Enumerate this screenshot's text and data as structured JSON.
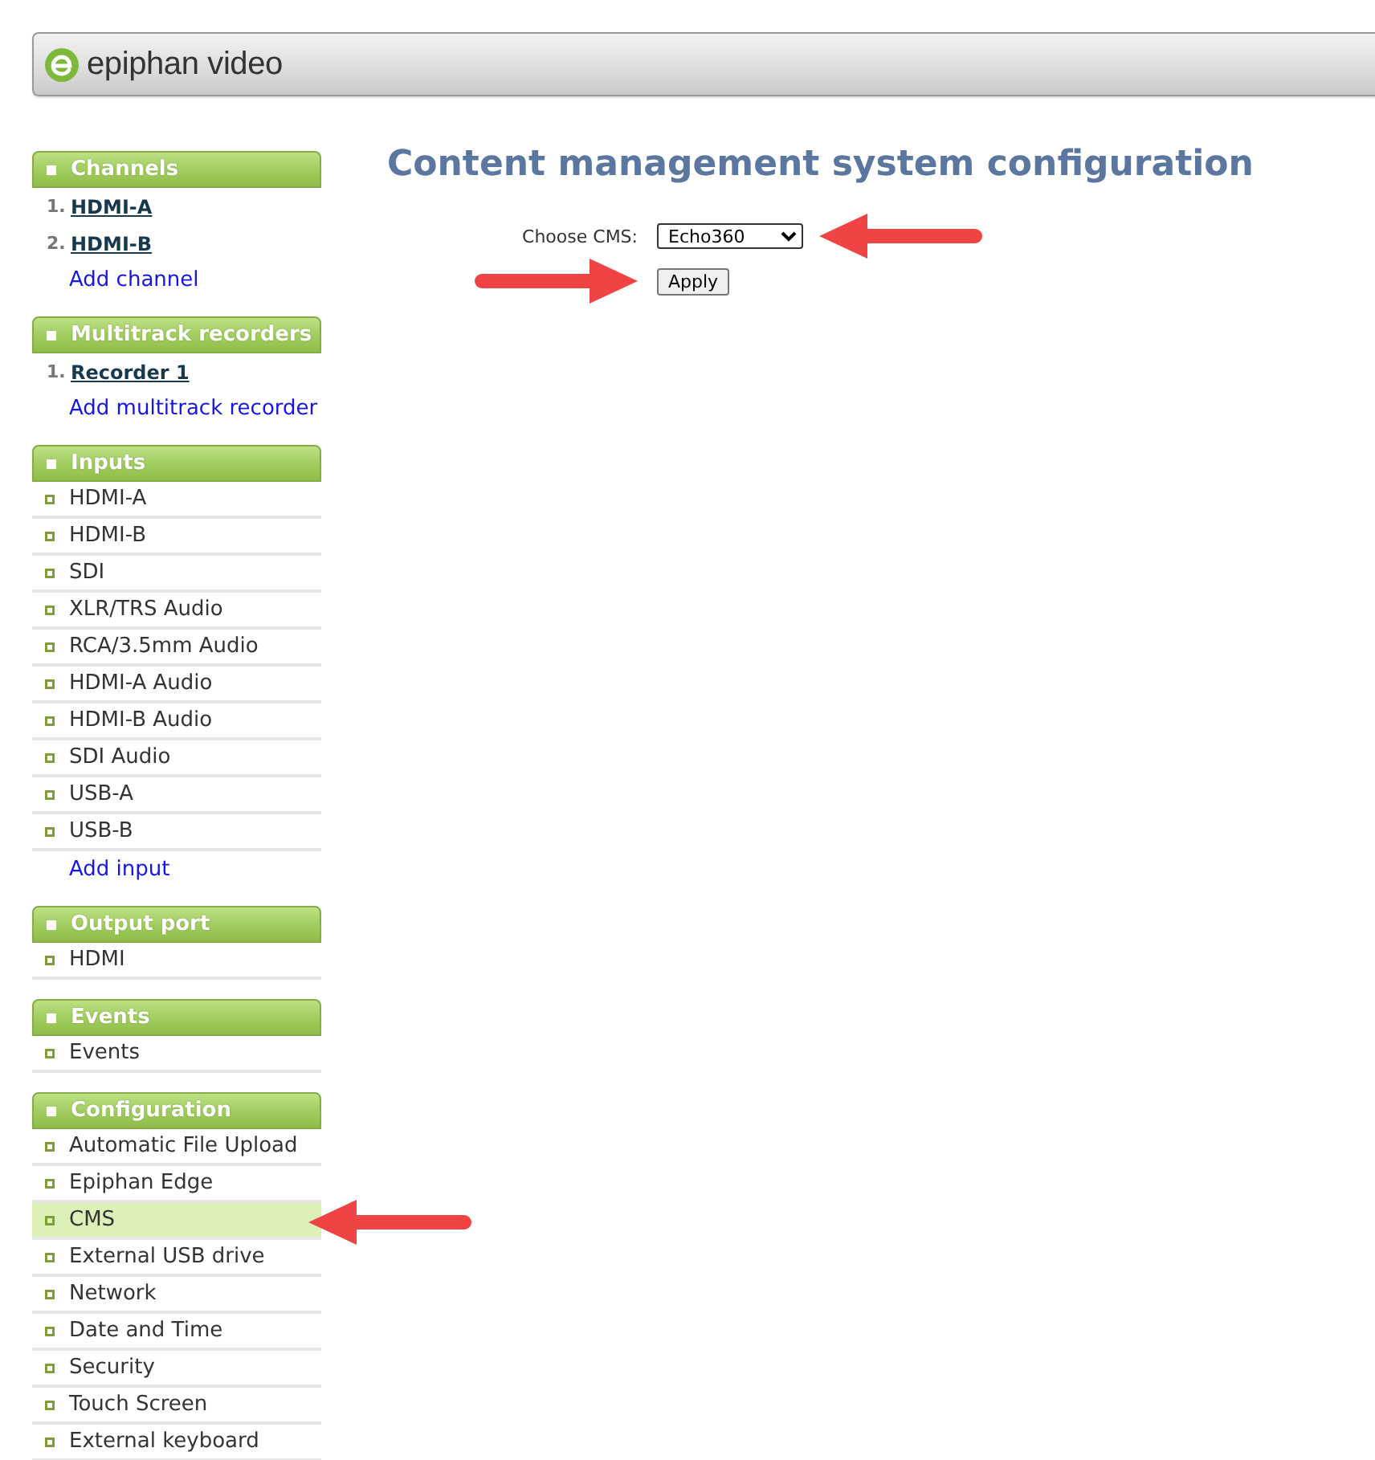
{
  "header": {
    "brand": "epiphan video"
  },
  "sidebar": {
    "sections": [
      {
        "title": "Channels",
        "items": [
          {
            "kind": "numbered",
            "number": "1.",
            "label": "HDMI-A",
            "selected": false
          },
          {
            "kind": "numbered",
            "number": "2.",
            "label": "HDMI-B",
            "selected": false
          },
          {
            "kind": "add",
            "label": "Add channel",
            "selected": false
          }
        ]
      },
      {
        "title": "Multitrack recorders",
        "items": [
          {
            "kind": "numbered",
            "number": "1.",
            "label": "Recorder 1",
            "selected": false
          },
          {
            "kind": "add",
            "label": "Add multitrack recorder",
            "selected": false
          }
        ]
      },
      {
        "title": "Inputs",
        "items": [
          {
            "kind": "link",
            "label": "HDMI-A",
            "selected": false
          },
          {
            "kind": "link",
            "label": "HDMI-B",
            "selected": false
          },
          {
            "kind": "link",
            "label": "SDI",
            "selected": false
          },
          {
            "kind": "link",
            "label": "XLR/TRS Audio",
            "selected": false
          },
          {
            "kind": "link",
            "label": "RCA/3.5mm Audio",
            "selected": false
          },
          {
            "kind": "link",
            "label": "HDMI-A Audio",
            "selected": false
          },
          {
            "kind": "link",
            "label": "HDMI-B Audio",
            "selected": false
          },
          {
            "kind": "link",
            "label": "SDI Audio",
            "selected": false
          },
          {
            "kind": "link",
            "label": "USB-A",
            "selected": false
          },
          {
            "kind": "link",
            "label": "USB-B",
            "selected": false
          },
          {
            "kind": "add",
            "label": "Add input",
            "selected": false
          }
        ]
      },
      {
        "title": "Output port",
        "items": [
          {
            "kind": "link",
            "label": "HDMI",
            "selected": false
          }
        ]
      },
      {
        "title": "Events",
        "items": [
          {
            "kind": "link",
            "label": "Events",
            "selected": false
          }
        ]
      },
      {
        "title": "Configuration",
        "items": [
          {
            "kind": "link",
            "label": "Automatic File Upload",
            "selected": false
          },
          {
            "kind": "link",
            "label": "Epiphan Edge",
            "selected": false
          },
          {
            "kind": "link",
            "label": "CMS",
            "selected": true
          },
          {
            "kind": "link",
            "label": "External USB drive",
            "selected": false
          },
          {
            "kind": "link",
            "label": "Network",
            "selected": false
          },
          {
            "kind": "link",
            "label": "Date and Time",
            "selected": false
          },
          {
            "kind": "link",
            "label": "Security",
            "selected": false
          },
          {
            "kind": "link",
            "label": "Touch Screen",
            "selected": false
          },
          {
            "kind": "link",
            "label": "External keyboard",
            "selected": false
          }
        ]
      }
    ]
  },
  "main": {
    "title": "Content management system configuration",
    "cms_field": {
      "label": "Choose CMS:",
      "value": "Echo360"
    },
    "apply_button": "Apply"
  }
}
